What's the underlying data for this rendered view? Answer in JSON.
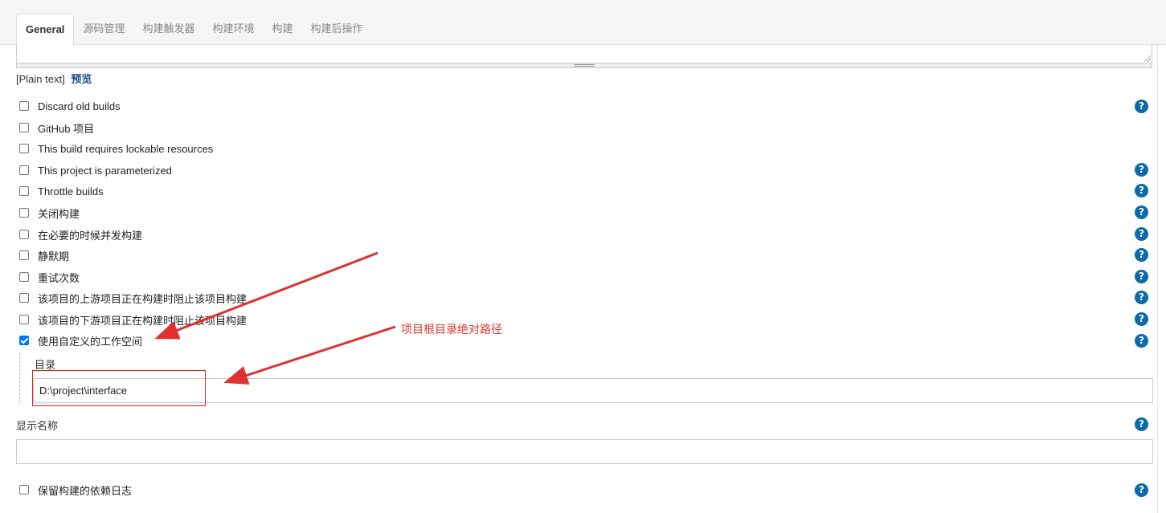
{
  "tabs": [
    {
      "label": "General",
      "active": true
    },
    {
      "label": "源码管理",
      "active": false
    },
    {
      "label": "构建触发器",
      "active": false
    },
    {
      "label": "构建环境",
      "active": false
    },
    {
      "label": "构建",
      "active": false
    },
    {
      "label": "构建后操作",
      "active": false
    }
  ],
  "description": {
    "format_label": "[Plain text]",
    "preview_link": "预览"
  },
  "options": [
    {
      "label": "Discard old builds",
      "checked": false,
      "has_help": true
    },
    {
      "label": "GitHub 项目",
      "checked": false,
      "has_help": false
    },
    {
      "label": "This build requires lockable resources",
      "checked": false,
      "has_help": false
    },
    {
      "label": "This project is parameterized",
      "checked": false,
      "has_help": true
    },
    {
      "label": "Throttle builds",
      "checked": false,
      "has_help": true
    },
    {
      "label": "关闭构建",
      "checked": false,
      "has_help": true
    },
    {
      "label": "在必要的时候并发构建",
      "checked": false,
      "has_help": true
    },
    {
      "label": "静默期",
      "checked": false,
      "has_help": true
    },
    {
      "label": "重试次数",
      "checked": false,
      "has_help": true
    },
    {
      "label": "该项目的上游项目正在构建时阻止该项目构建",
      "checked": false,
      "has_help": true
    },
    {
      "label": "该项目的下游项目正在构建时阻止该项目构建",
      "checked": false,
      "has_help": true
    },
    {
      "label": "使用自定义的工作空间",
      "checked": true,
      "has_help": true
    }
  ],
  "workspace": {
    "directory_label": "目录",
    "directory_value": "D:\\project\\interface"
  },
  "display_name": {
    "label": "显示名称",
    "value": ""
  },
  "keep_dependencies": {
    "label": "保留构建的依赖日志",
    "checked": false
  },
  "help_glyph": "?",
  "annotation": {
    "text": "项目根目录绝对路径",
    "color": "#e0362c"
  },
  "colors": {
    "accent": "#0b6aa8",
    "link": "#204a87",
    "checkbox_checked": "#0075ff",
    "annotation_red": "#e02020"
  }
}
